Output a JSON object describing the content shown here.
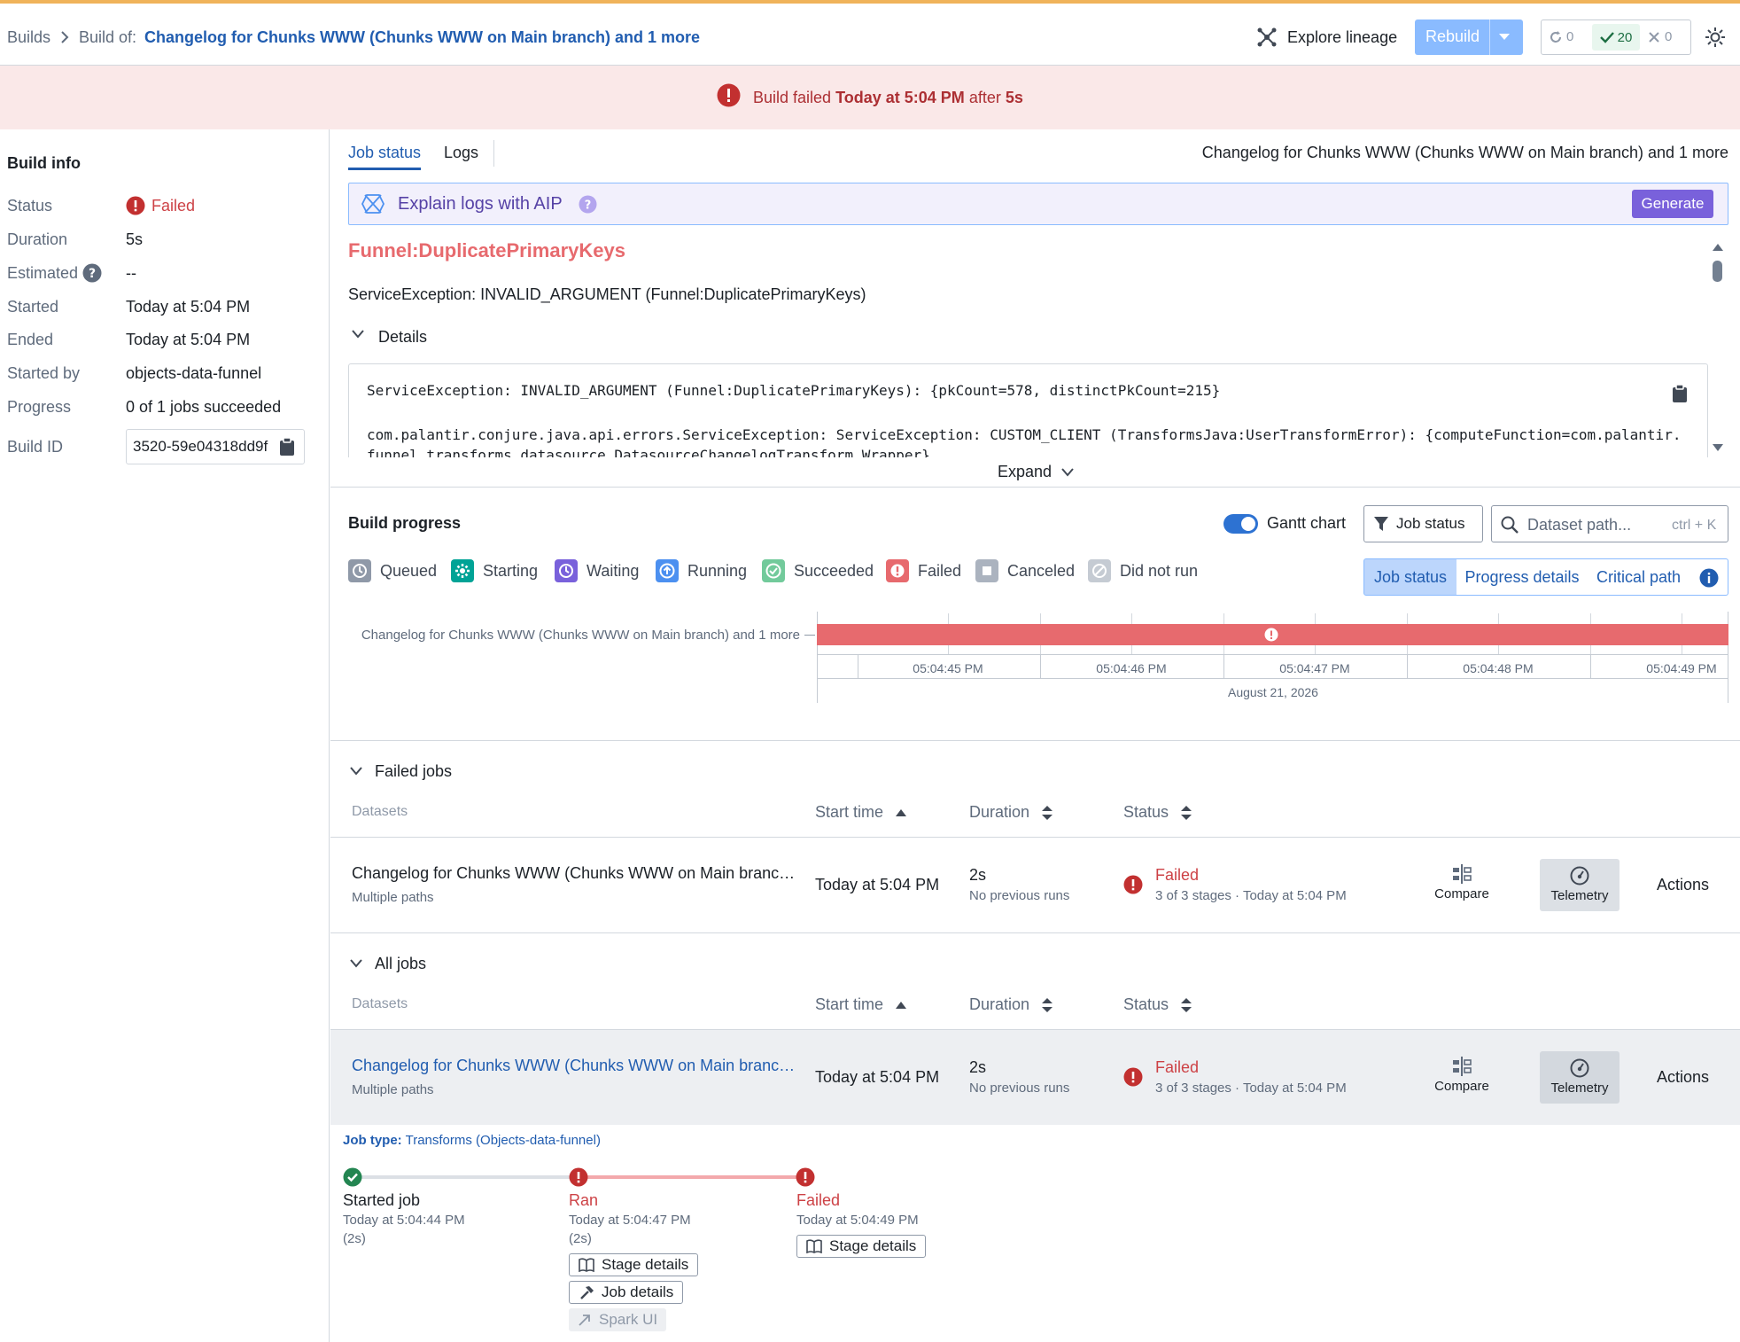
{
  "breadcrumb": {
    "builds": "Builds",
    "build_of_label": "Build of:",
    "build_of_link": "Changelog for Chunks WWW (Chunks WWW on Main branch) and 1 more"
  },
  "toolbar": {
    "explore_lineage": "Explore lineage",
    "rebuild": "Rebuild",
    "count_running": "0",
    "count_succeeded": "20",
    "count_failed": "0"
  },
  "banner": {
    "prefix": "Build failed",
    "when": "Today at 5:04 PM",
    "after": "after",
    "duration": "5s"
  },
  "build_info": {
    "title": "Build info",
    "status_label": "Status",
    "status_value": "Failed",
    "duration_label": "Duration",
    "duration_value": "5s",
    "estimated_label": "Estimated",
    "estimated_value": "--",
    "started_label": "Started",
    "started_value": "Today at 5:04 PM",
    "ended_label": "Ended",
    "ended_value": "Today at 5:04 PM",
    "started_by_label": "Started by",
    "started_by_value": "objects-data-funnel",
    "progress_label": "Progress",
    "progress_value": "0 of 1 jobs succeeded",
    "build_id_label": "Build ID",
    "build_id_value": "3520-59e04318dd9f"
  },
  "tabs": {
    "job_status": "Job status",
    "logs": "Logs",
    "header_title": "Changelog for Chunks WWW (Chunks WWW on Main branch) and 1 more"
  },
  "aip": {
    "label": "Explain logs with AIP",
    "generate": "Generate"
  },
  "error": {
    "title": "Funnel:DuplicatePrimaryKeys",
    "summary": "ServiceException: INVALID_ARGUMENT (Funnel:DuplicatePrimaryKeys)",
    "details_label": "Details",
    "log_line1": "ServiceException: INVALID_ARGUMENT (Funnel:DuplicatePrimaryKeys): {pkCount=578, distinctPkCount=215}",
    "log_line2": "com.palantir.conjure.java.api.errors.ServiceException: ServiceException: CUSTOM_CLIENT (TransformsJava:UserTransformError): {computeFunction=com.palantir.",
    "log_line3": "funnel.transforms.datasource.DatasourceChangelogTransform.Wrapper}",
    "expand": "Expand"
  },
  "build_progress": {
    "title": "Build progress",
    "gantt_toggle": "Gantt chart",
    "filter_button": "Job status",
    "search_placeholder": "Dataset path...",
    "search_shortcut": "ctrl + K",
    "legend": {
      "queued": "Queued",
      "starting": "Starting",
      "waiting": "Waiting",
      "running": "Running",
      "succeeded": "Succeeded",
      "failed": "Failed",
      "canceled": "Canceled",
      "did_not_run": "Did not run"
    },
    "views": {
      "job_status": "Job status",
      "progress_details": "Progress details",
      "critical_path": "Critical path"
    },
    "gantt": {
      "row_label": "Changelog for Chunks WWW (Chunks WWW on Main branch) and 1 more",
      "ticks": [
        "05:04:45 PM",
        "05:04:46 PM",
        "05:04:47 PM",
        "05:04:48 PM",
        "05:04:49 PM"
      ],
      "date": "August 21, 2026",
      "bar_color": "#e76a6e"
    }
  },
  "failed_jobs": {
    "title": "Failed jobs",
    "headers": {
      "datasets": "Datasets",
      "start_time": "Start time",
      "duration": "Duration",
      "status": "Status"
    },
    "row": {
      "dataset": "Changelog for Chunks WWW (Chunks WWW on Main branc…",
      "paths": "Multiple paths",
      "start": "Today at 5:04 PM",
      "duration": "2s",
      "duration_sub": "No previous runs",
      "status": "Failed",
      "status_sub": "3 of 3 stages · Today at 5:04 PM",
      "compare": "Compare",
      "telemetry": "Telemetry",
      "actions": "Actions"
    }
  },
  "all_jobs": {
    "title": "All jobs",
    "headers": {
      "datasets": "Datasets",
      "start_time": "Start time",
      "duration": "Duration",
      "status": "Status"
    },
    "row": {
      "dataset": "Changelog for Chunks WWW (Chunks WWW on Main branc…",
      "paths": "Multiple paths",
      "start": "Today at 5:04 PM",
      "duration": "2s",
      "duration_sub": "No previous runs",
      "status": "Failed",
      "status_sub": "3 of 3 stages · Today at 5:04 PM",
      "compare": "Compare",
      "telemetry": "Telemetry",
      "actions": "Actions"
    }
  },
  "job_detail": {
    "job_type_label": "Job type:",
    "job_type_value": "Transforms (Objects-data-funnel)",
    "stages": [
      {
        "name": "Started job",
        "time": "Today at 5:04:44 PM",
        "dur": "(2s)"
      },
      {
        "name": "Ran",
        "time": "Today at 5:04:47 PM",
        "dur": "(2s)"
      },
      {
        "name": "Failed",
        "time": "Today at 5:04:49 PM",
        "dur": ""
      }
    ],
    "stage_details": "Stage details",
    "job_details": "Job details",
    "spark_ui": "Spark UI"
  },
  "colors": {
    "accent": "#215db0",
    "danger": "#cd4246",
    "success": "#238551",
    "aip_purple": "#7961db"
  }
}
